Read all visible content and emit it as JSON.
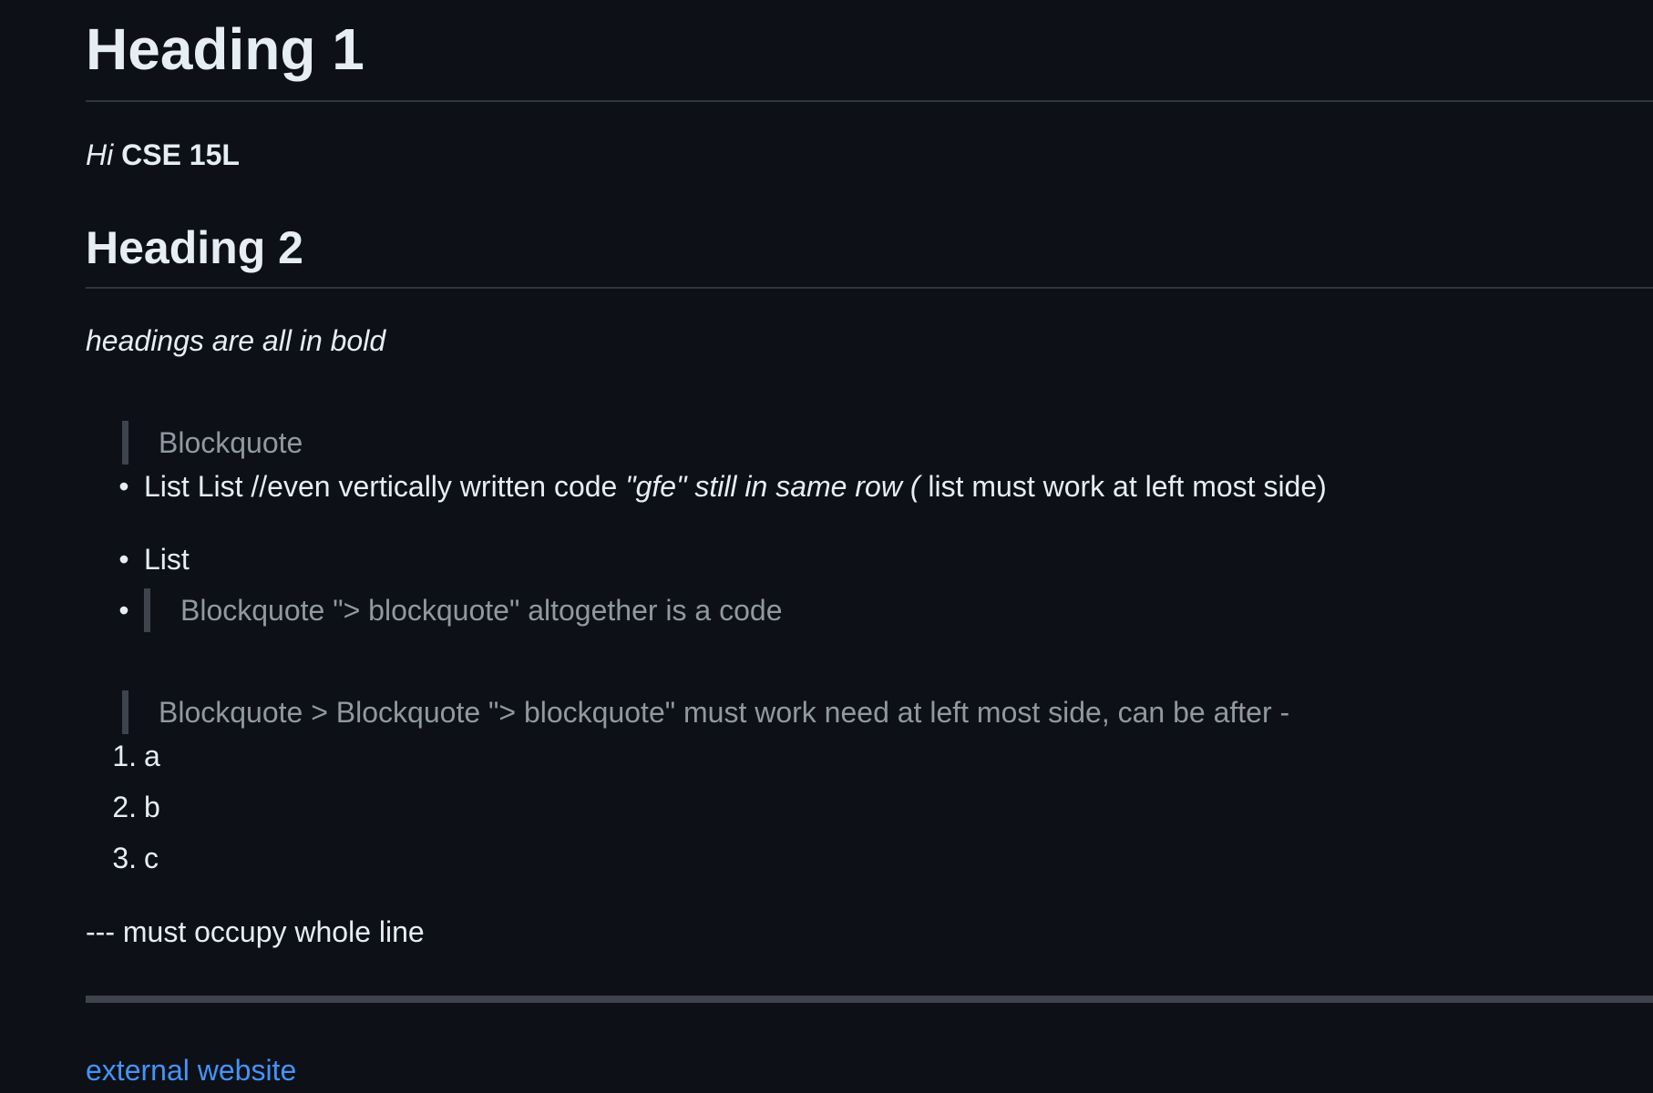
{
  "document": {
    "heading1": "Heading 1",
    "paragraph1": {
      "italic": "Hi",
      "bold": "CSE 15L"
    },
    "heading2": "Heading 2",
    "paragraph2_italic": "headings are all in bold",
    "blockquote1": "Blockquote",
    "list": {
      "bullet": "•",
      "item1": {
        "text_start": "List List //even vertically written code ",
        "italic": "\"gfe\" still in same row ( ",
        "text_end": "list must work at left most side)"
      },
      "item2": "List",
      "item3_blockquote": "Blockquote \"> blockquote\" altogether is a code"
    },
    "blockquote2": "Blockquote > Blockquote \"> blockquote\" must work need at left most side, can be after -",
    "ordered_list": [
      {
        "num": "1.",
        "text": "a"
      },
      {
        "num": "2.",
        "text": "b"
      },
      {
        "num": "3.",
        "text": "c"
      }
    ],
    "paragraph3": "--- must occupy whole line",
    "link": "external website"
  },
  "colors": {
    "background": "#0d1117",
    "text": "#e6edf3",
    "muted": "#9198a1",
    "border": "#30363d",
    "link": "#4493f8"
  }
}
